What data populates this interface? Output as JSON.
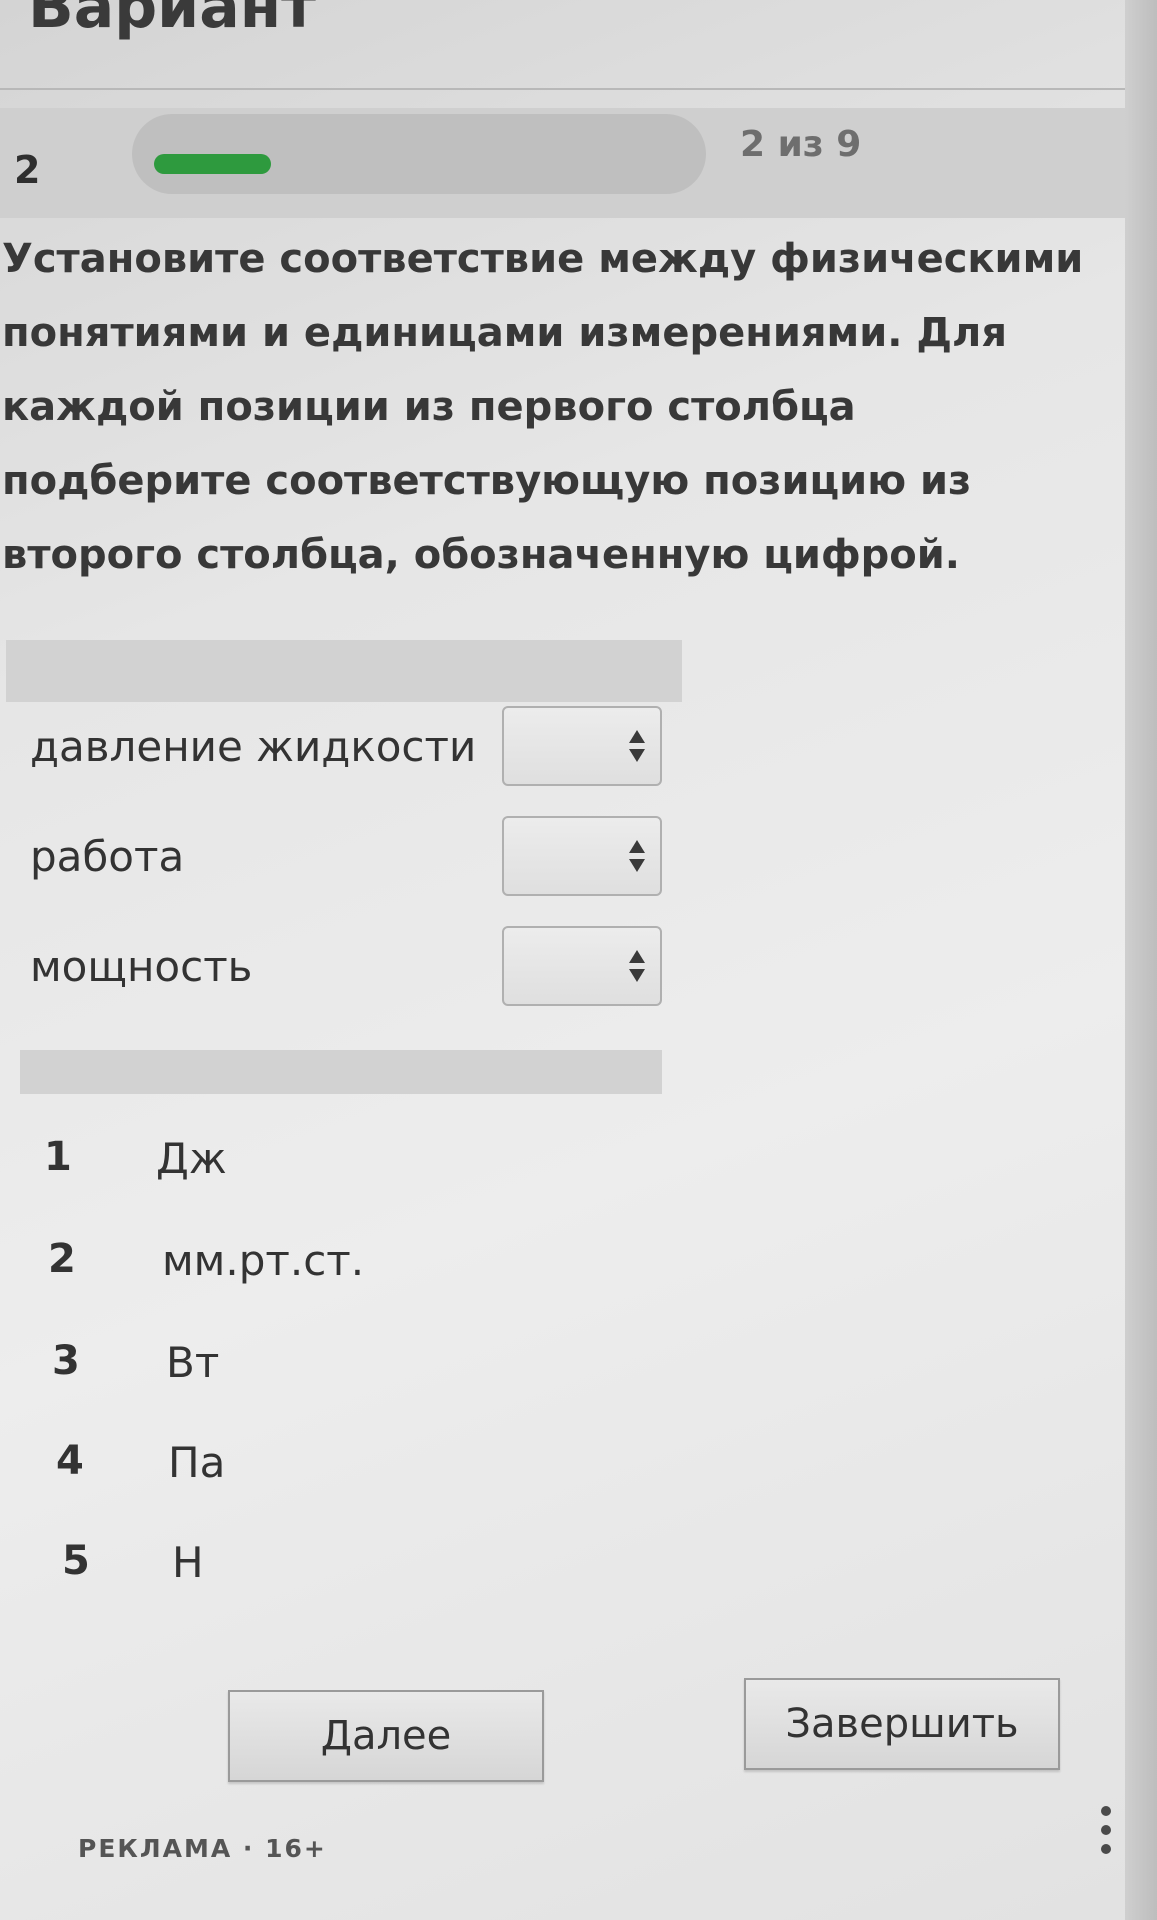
{
  "header": {
    "title": "Вариант"
  },
  "progress": {
    "question_number": "2",
    "counter_text": "2 из 9",
    "fraction": 0.22,
    "fill_color": "#2e9a3e"
  },
  "question": {
    "text": "Установите соответствие между физическими понятиями и единицами измерениями. Для каждой позиции из первого столбца подберите соответствующую позицию из второго столбца, обозначенную цифрой."
  },
  "matches": [
    {
      "label": "давление жидкости",
      "selected": ""
    },
    {
      "label": "работа",
      "selected": ""
    },
    {
      "label": "мощность",
      "selected": ""
    }
  ],
  "options": [
    {
      "num": "1",
      "unit": "Дж"
    },
    {
      "num": "2",
      "unit": "мм.рт.ст."
    },
    {
      "num": "3",
      "unit": "Вт"
    },
    {
      "num": "4",
      "unit": "Па"
    },
    {
      "num": "5",
      "unit": "Н"
    }
  ],
  "buttons": {
    "next_label": "Далее",
    "finish_label": "Завершить"
  },
  "ad": {
    "label": "РЕКЛАМА · 16+"
  },
  "icons": {
    "select_arrows": "up-down-arrows-icon",
    "menu": "more-vertical-icon"
  }
}
